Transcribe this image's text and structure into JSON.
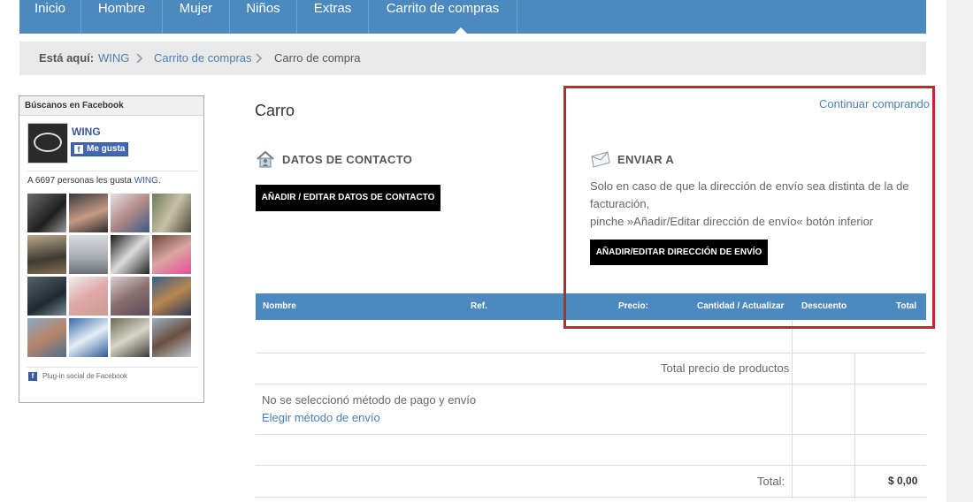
{
  "nav": {
    "items": [
      {
        "label": "Inicio"
      },
      {
        "label": "Hombre"
      },
      {
        "label": "Mujer"
      },
      {
        "label": "Niños"
      },
      {
        "label": "Extras"
      },
      {
        "label": "Carrito de compras",
        "active": true
      }
    ]
  },
  "breadcrumb": {
    "prefix": "Está aquí:",
    "items": [
      "WING",
      "Carrito de compras",
      "Carro de compra"
    ]
  },
  "facebook": {
    "title": "Búscanos en Facebook",
    "page_name": "WING",
    "like_label": "Me gusta",
    "count_text": "A 6697 personas les gusta",
    "count_link": "WING",
    "count_end": ".",
    "plugin_label": "Plug-in social de Facebook"
  },
  "cart": {
    "title": "Carro",
    "continue_label": "Continuar comprando",
    "contact": {
      "title": "DATOS DE CONTACTO",
      "button": "AÑADIR / EDITAR DATOS DE CONTACTO"
    },
    "shipping": {
      "title": "ENVIAR A",
      "line1": "Solo en caso de que la dirección de envío sea distinta de la de",
      "line2": "facturación,",
      "line3": "pinche »Añadir/Editar dirección de envío« botón inferior",
      "button": "AÑADIR/EDITAR DIRECCIÓN DE ENVÍO"
    },
    "table": {
      "columns": [
        "Nombre",
        "Ref.",
        "Precio:",
        "Cantidad / Actualizar",
        "Descuento",
        "Total"
      ],
      "products_total_label": "Total precio de productos",
      "no_method": "No se seleccionó método de pago y envío",
      "choose_method": "Elegir método de envío",
      "total_label": "Total:",
      "total_value": "$ 0,00"
    }
  },
  "colors": {
    "nav": "#4b89bf",
    "link": "#4b7fb3",
    "highlight": "#c4262e"
  }
}
